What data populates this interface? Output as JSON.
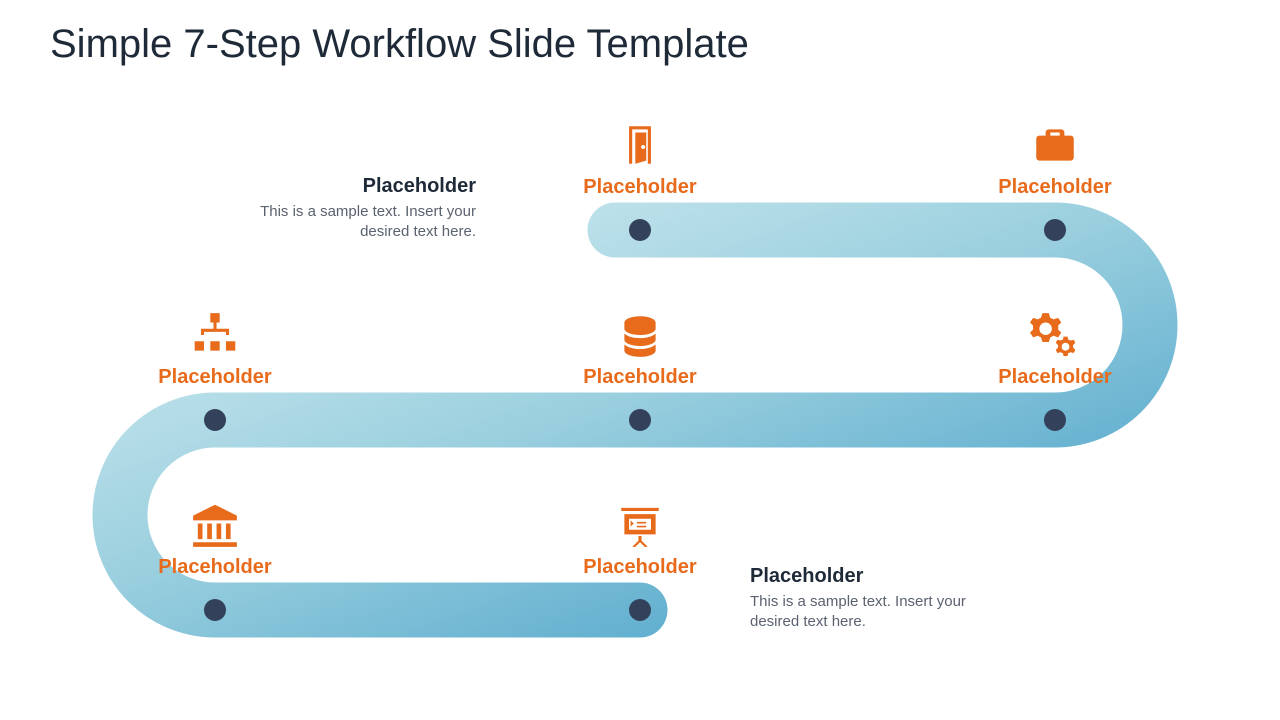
{
  "title": "Simple 7-Step Workflow Slide Template",
  "colors": {
    "accent": "#e86b1c",
    "dark": "#34415a",
    "path_light": "#cfeaf0",
    "path_mid": "#87c7d8",
    "path_deep": "#4aa1c6"
  },
  "notes": {
    "start": {
      "title": "Placeholder",
      "body": "This is a sample text. Insert your desired text here."
    },
    "end": {
      "title": "Placeholder",
      "body": "This is a sample text. Insert your desired text here."
    }
  },
  "steps": [
    {
      "id": 1,
      "label": "Placeholder",
      "icon": "door-icon"
    },
    {
      "id": 2,
      "label": "Placeholder",
      "icon": "briefcase-icon"
    },
    {
      "id": 3,
      "label": "Placeholder",
      "icon": "gears-icon"
    },
    {
      "id": 4,
      "label": "Placeholder",
      "icon": "database-icon"
    },
    {
      "id": 5,
      "label": "Placeholder",
      "icon": "org-chart-icon"
    },
    {
      "id": 6,
      "label": "Placeholder",
      "icon": "bank-icon"
    },
    {
      "id": 7,
      "label": "Placeholder",
      "icon": "presentation-icon"
    }
  ]
}
